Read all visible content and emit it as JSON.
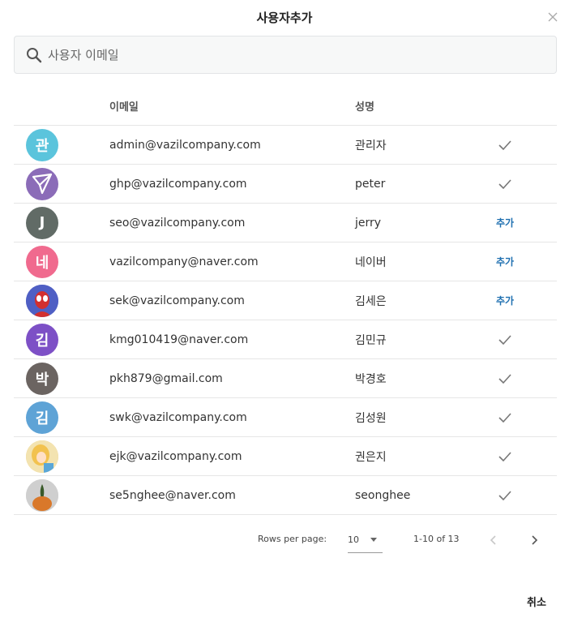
{
  "dialog": {
    "title": "사용자추가"
  },
  "search": {
    "placeholder": "사용자 이메일"
  },
  "table": {
    "columns": {
      "email": "이메일",
      "name": "성명"
    },
    "rows": [
      {
        "avatar_text": "관",
        "avatar_color": "#5bc4dc",
        "avatar_icon": "",
        "email": "admin@vazilcompany.com",
        "name": "관리자",
        "action": "check"
      },
      {
        "avatar_text": "",
        "avatar_color": "#8b6cb8",
        "avatar_icon": "paper-plane-icon",
        "email": "ghp@vazilcompany.com",
        "name": "peter",
        "action": "check"
      },
      {
        "avatar_text": "J",
        "avatar_color": "#616b66",
        "avatar_icon": "",
        "email": "seo@vazilcompany.com",
        "name": "jerry",
        "action": "add"
      },
      {
        "avatar_text": "네",
        "avatar_color": "#f06a8e",
        "avatar_icon": "",
        "email": "vazilcompany@naver.com",
        "name": "네이버",
        "action": "add"
      },
      {
        "avatar_text": "",
        "avatar_color": "#4f5fc4",
        "avatar_icon": "spiderman-photo-icon",
        "email": "sek@vazilcompany.com",
        "name": "김세은",
        "action": "add"
      },
      {
        "avatar_text": "김",
        "avatar_color": "#7d50c6",
        "avatar_icon": "",
        "email": "kmg010419@naver.com",
        "name": "김민규",
        "action": "check"
      },
      {
        "avatar_text": "박",
        "avatar_color": "#6b6461",
        "avatar_icon": "",
        "email": "pkh879@gmail.com",
        "name": "박경호",
        "action": "check"
      },
      {
        "avatar_text": "김",
        "avatar_color": "#5ea3d6",
        "avatar_icon": "",
        "email": "swk@vazilcompany.com",
        "name": "김성원",
        "action": "check"
      },
      {
        "avatar_text": "",
        "avatar_color": "#e9c36a",
        "avatar_icon": "alice-photo-icon",
        "email": "ejk@vazilcompany.com",
        "name": "권은지",
        "action": "check"
      },
      {
        "avatar_text": "",
        "avatar_color": "#c9c9c9",
        "avatar_icon": "pumpkin-photo-icon",
        "email": "se5nghee@naver.com",
        "name": "seonghee",
        "action": "check"
      }
    ],
    "add_label": "추가"
  },
  "pagination": {
    "rows_per_page_label": "Rows per page:",
    "rows_per_page": "10",
    "range": "1-10 of 13"
  },
  "footer": {
    "cancel_label": "취소"
  },
  "colors": {
    "accent": "#1e6fb0",
    "check": "#777777"
  }
}
